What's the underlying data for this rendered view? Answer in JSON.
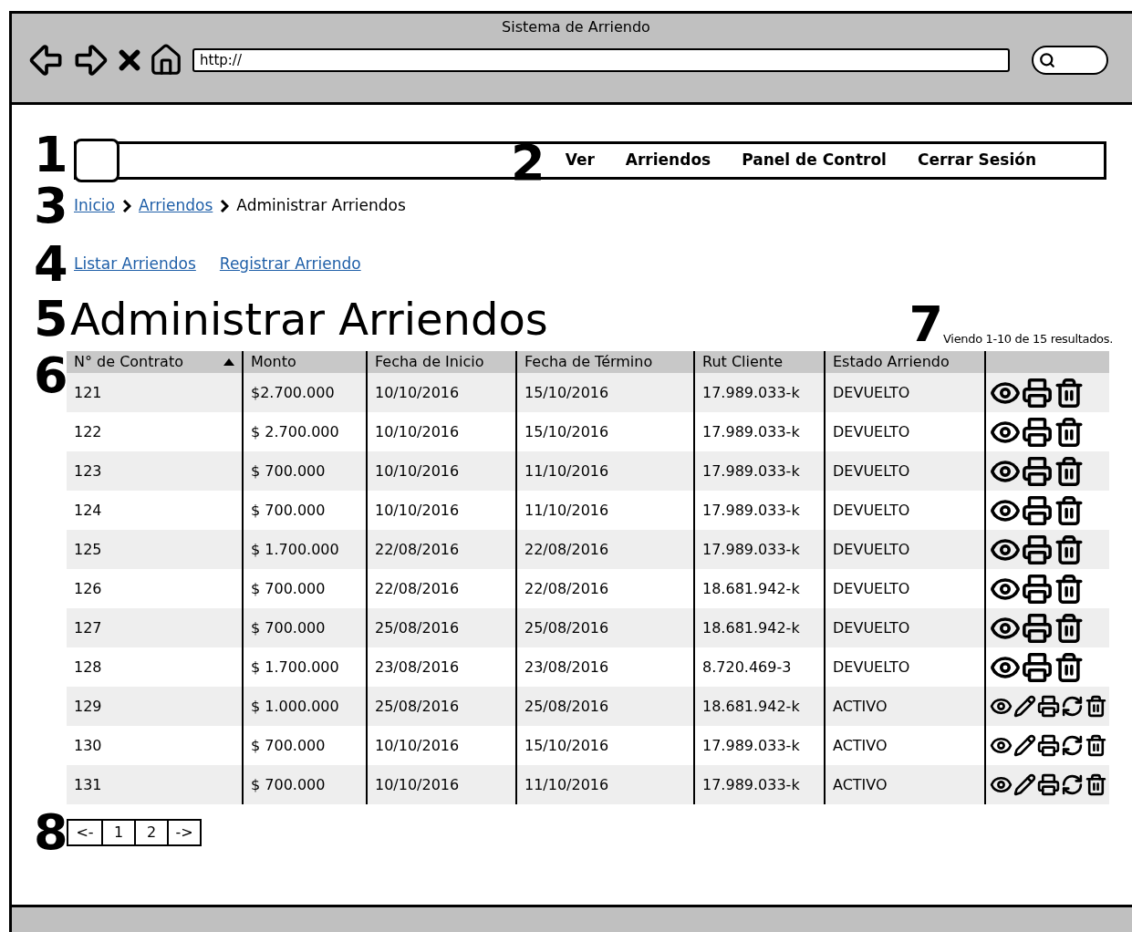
{
  "window": {
    "title": "Sistema de Arriendo",
    "url": "http://"
  },
  "callouts": [
    "1",
    "2",
    "3",
    "4",
    "5",
    "6",
    "7",
    "8"
  ],
  "nav": {
    "items": [
      "Ver",
      "Arriendos",
      "Panel de Control",
      "Cerrar Sesión"
    ]
  },
  "breadcrumb": {
    "links": [
      "Inicio",
      "Arriendos"
    ],
    "current": "Administrar Arriendos"
  },
  "actions": [
    "Listar Arriendos",
    "Registrar Arriendo"
  ],
  "heading": "Administrar Arriendos",
  "summary": "Viendo 1-10 de 15 resultados.",
  "table": {
    "columns": [
      {
        "label": "N° de Contrato",
        "sorted": true
      },
      {
        "label": "Monto",
        "sorted": false
      },
      {
        "label": "Fecha de Inicio",
        "sorted": false
      },
      {
        "label": "Fecha de Término",
        "sorted": false
      },
      {
        "label": "Rut Cliente",
        "sorted": false
      },
      {
        "label": "Estado Arriendo",
        "sorted": false
      }
    ],
    "rows": [
      {
        "cells": [
          "121",
          "$2.700.000",
          "10/10/2016",
          "15/10/2016",
          "17.989.033-k",
          "DEVUELTO"
        ],
        "kind": "returned"
      },
      {
        "cells": [
          "122",
          "$ 2.700.000",
          "10/10/2016",
          "15/10/2016",
          "17.989.033-k",
          "DEVUELTO"
        ],
        "kind": "returned"
      },
      {
        "cells": [
          "123",
          "$ 700.000",
          "10/10/2016",
          "11/10/2016",
          "17.989.033-k",
          "DEVUELTO"
        ],
        "kind": "returned"
      },
      {
        "cells": [
          "124",
          "$ 700.000",
          "10/10/2016",
          "11/10/2016",
          "17.989.033-k",
          "DEVUELTO"
        ],
        "kind": "returned"
      },
      {
        "cells": [
          "125",
          "$ 1.700.000",
          "22/08/2016",
          "22/08/2016",
          "17.989.033-k",
          "DEVUELTO"
        ],
        "kind": "returned"
      },
      {
        "cells": [
          "126",
          "$ 700.000",
          "22/08/2016",
          "22/08/2016",
          "18.681.942-k",
          "DEVUELTO"
        ],
        "kind": "returned"
      },
      {
        "cells": [
          "127",
          "$ 700.000",
          "25/08/2016",
          "25/08/2016",
          "18.681.942-k",
          "DEVUELTO"
        ],
        "kind": "returned"
      },
      {
        "cells": [
          "128",
          "$ 1.700.000",
          "23/08/2016",
          "23/08/2016",
          "8.720.469-3",
          "DEVUELTO"
        ],
        "kind": "returned"
      },
      {
        "cells": [
          "129",
          "$ 1.000.000",
          "25/08/2016",
          "25/08/2016",
          "18.681.942-k",
          "ACTIVO"
        ],
        "kind": "active"
      },
      {
        "cells": [
          "130",
          "$ 700.000",
          "10/10/2016",
          "15/10/2016",
          "17.989.033-k",
          "ACTIVO"
        ],
        "kind": "active"
      },
      {
        "cells": [
          "131",
          "$ 700.000",
          "10/10/2016",
          "11/10/2016",
          "17.989.033-k",
          "ACTIVO"
        ],
        "kind": "active"
      }
    ]
  },
  "pagination": [
    "<-",
    "1",
    "2",
    "->"
  ]
}
